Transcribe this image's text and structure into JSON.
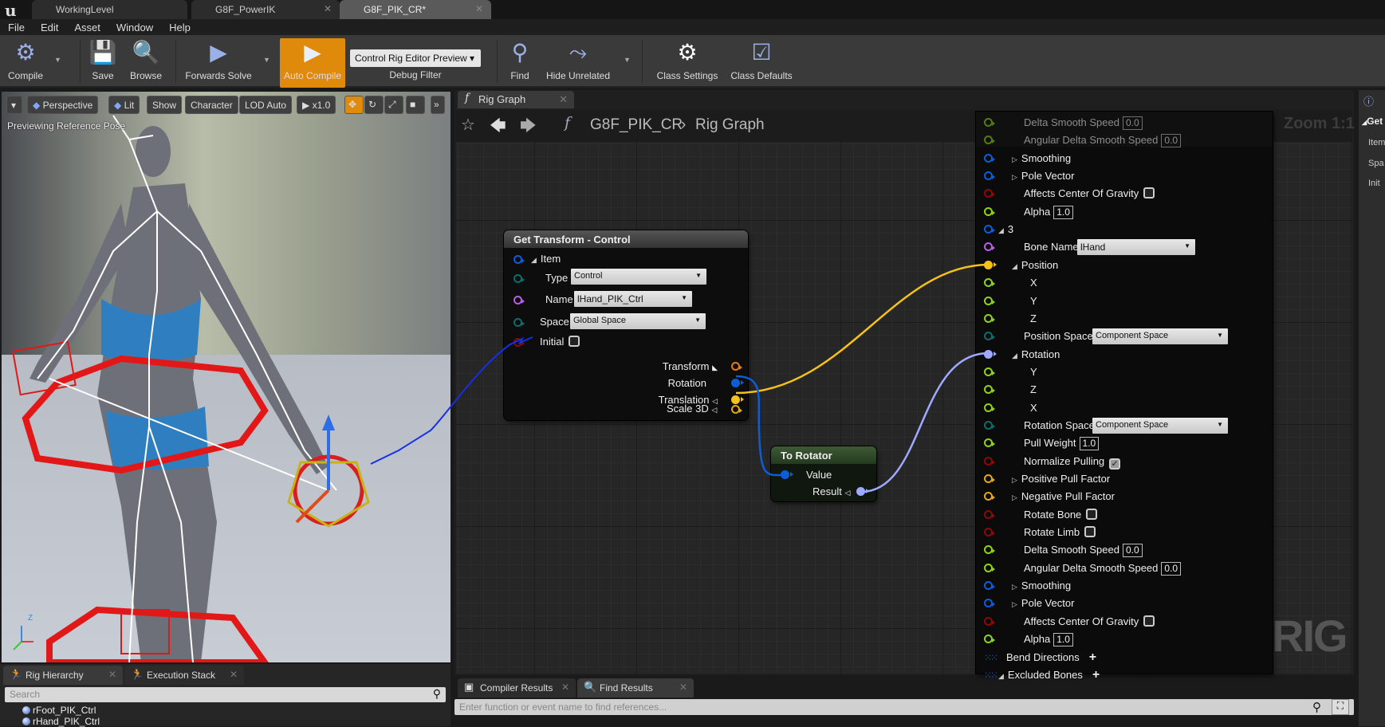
{
  "window": {
    "tabs": [
      {
        "label": "WorkingLevel",
        "active": false
      },
      {
        "label": "G8F_PowerIK",
        "active": false
      },
      {
        "label": "G8F_PIK_CR*",
        "active": true
      }
    ],
    "logo": "u"
  },
  "menu": [
    "File",
    "Edit",
    "Asset",
    "Window",
    "Help"
  ],
  "toolbar": {
    "compile": "Compile",
    "save": "Save",
    "browse": "Browse",
    "forwards_solve": "Forwards Solve",
    "auto_compile": "Auto Compile",
    "debug_select": "Control Rig Editor Preview",
    "debug_filter": "Debug Filter",
    "find": "Find",
    "hide_unrelated": "Hide Unrelated",
    "class_settings": "Class Settings",
    "class_defaults": "Class Defaults",
    "accent_color": "#e08a0c"
  },
  "viewport": {
    "buttons": {
      "perspective": "Perspective",
      "lit": "Lit",
      "show": "Show",
      "character": "Character",
      "lod": "LOD Auto",
      "speed": "x1.0"
    },
    "status": "Previewing Reference Pose",
    "axis_z": "Z"
  },
  "left_panel": {
    "tabs": [
      "Rig Hierarchy",
      "Execution Stack"
    ],
    "search_placeholder": "Search",
    "items": [
      "rFoot_PIK_Ctrl",
      "rHand_PIK_Ctrl"
    ]
  },
  "graph": {
    "tab": "Rig Graph",
    "breadcrumb": [
      "G8F_PIK_CR",
      "Rig Graph"
    ],
    "zoom": "Zoom 1:1",
    "watermark": "RIG",
    "get_transform": {
      "title": "Get Transform - Control",
      "item": "Item",
      "type_label": "Type",
      "type_value": "Control",
      "name_label": "Name",
      "name_value": "lHand_PIK_Ctrl",
      "space_label": "Space",
      "space_value": "Global Space",
      "initial_label": "Initial",
      "initial_checked": false,
      "outputs": [
        "Transform",
        "Rotation",
        "Translation",
        "Scale 3D"
      ]
    },
    "to_rotator": {
      "title": "To Rotator",
      "input": "Value",
      "output": "Result"
    },
    "pin_colors": {
      "float": "#8ed21a",
      "struct": "#0b5ed7",
      "bool": "#8a0a0a",
      "name": "#b760e0",
      "enum": "#0d6e66",
      "vector": "#f5c21a",
      "rotator": "#9fa9ff",
      "transform": "#e87a12",
      "pull": "#e0a81a"
    },
    "big_node_rows": [
      {
        "label": "Delta Smooth Speed",
        "pin": "float",
        "lvl": 1,
        "num": "0.0"
      },
      {
        "label": "Angular Delta Smooth Speed",
        "pin": "float",
        "lvl": 1,
        "num": "0.0"
      },
      {
        "label": "Smoothing",
        "pin": "struct",
        "lvl": 1,
        "tri": "▷"
      },
      {
        "label": "Pole Vector",
        "pin": "struct",
        "lvl": 1,
        "tri": "▷"
      },
      {
        "label": "Affects Center Of Gravity",
        "pin": "bool",
        "lvl": 1,
        "check": false
      },
      {
        "label": "Alpha",
        "pin": "float",
        "lvl": 1,
        "num": "1.0"
      },
      {
        "label": "3",
        "pin": "struct",
        "lvl": 0,
        "tri": "◢"
      },
      {
        "label": "Bone Name",
        "pin": "name",
        "lvl": 1,
        "dd": "lHand"
      },
      {
        "label": "Position",
        "pin": "vector",
        "lvl": 1,
        "tri": "◢",
        "filled": true
      },
      {
        "label": "X",
        "pin": "float",
        "lvl": 2
      },
      {
        "label": "Y",
        "pin": "float",
        "lvl": 2
      },
      {
        "label": "Z",
        "pin": "float",
        "lvl": 2
      },
      {
        "label": "Position Space",
        "pin": "enum",
        "lvl": 1,
        "dd": "Component Space"
      },
      {
        "label": "Rotation",
        "pin": "rotator",
        "lvl": 1,
        "tri": "◢",
        "filled": true
      },
      {
        "label": "Y",
        "pin": "float",
        "lvl": 2
      },
      {
        "label": "Z",
        "pin": "float",
        "lvl": 2
      },
      {
        "label": "X",
        "pin": "float",
        "lvl": 2
      },
      {
        "label": "Rotation Space",
        "pin": "enum",
        "lvl": 1,
        "dd": "Component Space"
      },
      {
        "label": "Pull Weight",
        "pin": "float",
        "lvl": 1,
        "num": "1.0"
      },
      {
        "label": "Normalize Pulling",
        "pin": "bool",
        "lvl": 1,
        "check": true
      },
      {
        "label": "Positive Pull Factor",
        "pin": "pull",
        "lvl": 1,
        "tri": "▷"
      },
      {
        "label": "Negative Pull Factor",
        "pin": "pull",
        "lvl": 1,
        "tri": "▷"
      },
      {
        "label": "Rotate Bone",
        "pin": "bool",
        "lvl": 1,
        "check": false
      },
      {
        "label": "Rotate Limb",
        "pin": "bool",
        "lvl": 1,
        "check": false
      },
      {
        "label": "Delta Smooth Speed",
        "pin": "float",
        "lvl": 1,
        "num": "0.0"
      },
      {
        "label": "Angular Delta Smooth Speed",
        "pin": "float",
        "lvl": 1,
        "num": "0.0"
      },
      {
        "label": "Smoothing",
        "pin": "struct",
        "lvl": 1,
        "tri": "▷"
      },
      {
        "label": "Pole Vector",
        "pin": "struct",
        "lvl": 1,
        "tri": "▷"
      },
      {
        "label": "Affects Center Of Gravity",
        "pin": "bool",
        "lvl": 1,
        "check": false
      },
      {
        "label": "Alpha",
        "pin": "float",
        "lvl": 1,
        "num": "1.0"
      },
      {
        "label": "Bend Directions",
        "pin": "array",
        "lvl": 0,
        "plus": "+"
      },
      {
        "label": "Excluded Bones",
        "pin": "array",
        "lvl": 0,
        "tri": "◢",
        "plus": "+"
      }
    ]
  },
  "bottom_panel": {
    "tabs": [
      "Compiler Results",
      "Find Results"
    ],
    "find_placeholder": "Enter function or event name to find references..."
  },
  "details": {
    "items": [
      "Get",
      "Item",
      "Spa",
      "Init"
    ]
  }
}
